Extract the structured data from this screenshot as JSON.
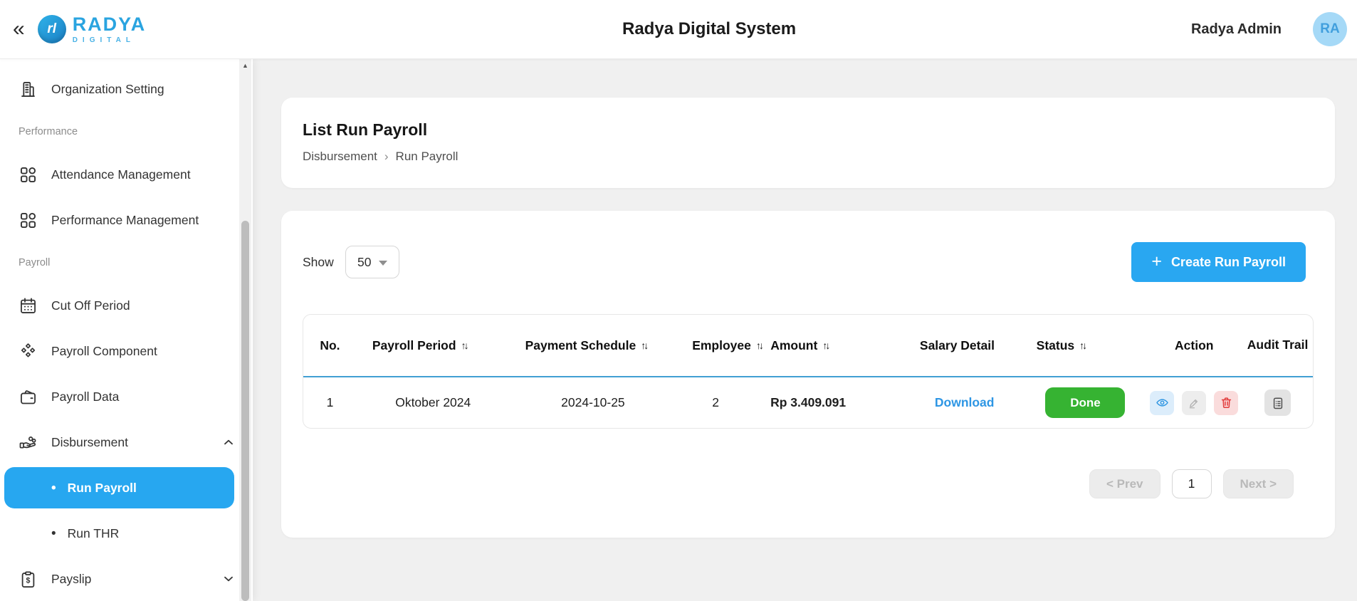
{
  "header": {
    "collapse_icon": "«",
    "logo": {
      "monogram": "rl",
      "title": "RADYA",
      "subtitle": "DIGITAL"
    },
    "app_title": "Radya Digital System",
    "user_name": "Radya Admin",
    "avatar_initials": "RA"
  },
  "sidebar": {
    "items": [
      {
        "label": "Organization Setting",
        "icon": "building-icon"
      },
      {
        "label": "Performance",
        "type": "section"
      },
      {
        "label": "Attendance Management",
        "icon": "grid-icon"
      },
      {
        "label": "Performance Management",
        "icon": "grid-icon"
      },
      {
        "label": "Payroll",
        "type": "section"
      },
      {
        "label": "Cut Off Period",
        "icon": "calendar-icon"
      },
      {
        "label": "Payroll Component",
        "icon": "diamonds-icon"
      },
      {
        "label": "Payroll Data",
        "icon": "wallet-icon"
      },
      {
        "label": "Disbursement",
        "icon": "hand-coins-icon",
        "state": "expanded"
      },
      {
        "label": "Run Payroll",
        "bullet": "•",
        "active": true
      },
      {
        "label": "Run THR",
        "bullet": "•",
        "active": false
      },
      {
        "label": "Payslip",
        "icon": "payslip-icon",
        "state": "collapsed"
      }
    ]
  },
  "page": {
    "title": "List Run Payroll",
    "breadcrumb": {
      "parent": "Disbursement",
      "separator": "›",
      "current": "Run Payroll"
    }
  },
  "toolbar": {
    "show_label": "Show",
    "page_size": "50",
    "create_button_icon": "+",
    "create_button": "Create Run Payroll"
  },
  "table": {
    "sort_indicator": "↑↓",
    "columns": [
      {
        "label": "No.",
        "sortable": false
      },
      {
        "label": "Payroll Period",
        "sortable": true
      },
      {
        "label": "Payment Schedule",
        "sortable": true
      },
      {
        "label": "Employee",
        "sortable": true
      },
      {
        "label": "Amount",
        "sortable": true
      },
      {
        "label": "Salary Detail",
        "sortable": false
      },
      {
        "label": "Status",
        "sortable": true
      },
      {
        "label": "Action",
        "sortable": false
      },
      {
        "label": "Audit Trail",
        "sortable": false
      }
    ],
    "rows": [
      {
        "no": "1",
        "payroll_period": "Oktober 2024",
        "payment_schedule": "2024-10-25",
        "employee": "2",
        "amount": "Rp 3.409.091",
        "salary_detail": "Download",
        "status": "Done"
      }
    ]
  },
  "pagination": {
    "prev": "< Prev",
    "page": "1",
    "next": "Next >"
  },
  "colors": {
    "accent_blue": "#29a7f1",
    "active_item_blue": "#27a7f0",
    "status_done_green": "#36b332",
    "link_blue": "#2e96e4",
    "header_underline_blue": "#419fd3",
    "delete_red": "#e23b3b",
    "avatar_bg": "#a5d9f7",
    "page_background": "#f0f0f0"
  }
}
